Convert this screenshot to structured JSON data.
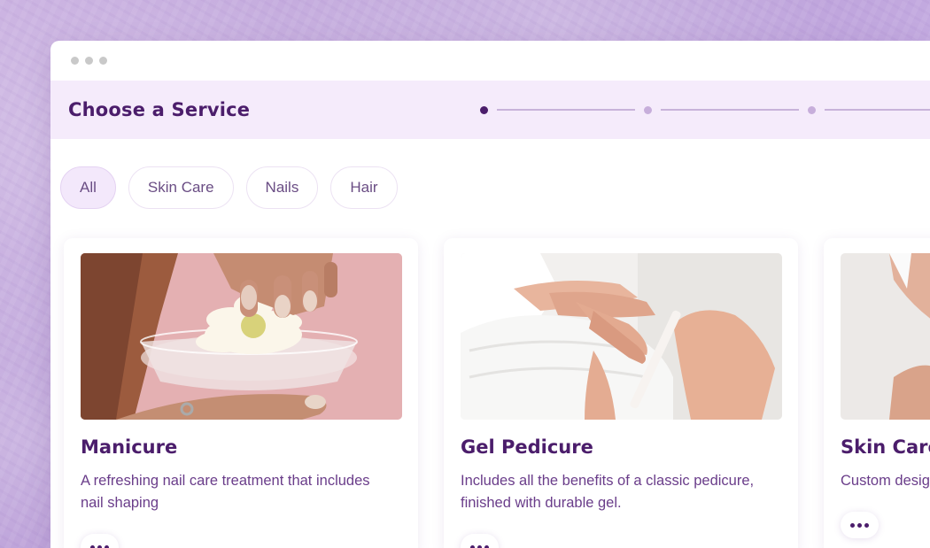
{
  "header": {
    "title": "Choose a Service"
  },
  "filters": [
    {
      "label": "All",
      "active": true
    },
    {
      "label": "Skin Care",
      "active": false
    },
    {
      "label": "Nails",
      "active": false
    },
    {
      "label": "Hair",
      "active": false
    }
  ],
  "steps": {
    "count": 3,
    "current": 1
  },
  "cards": [
    {
      "title": "Manicure",
      "description": "A refreshing nail care treatment that includes nail shaping",
      "image": "manicure-photo"
    },
    {
      "title": "Gel Pedicure",
      "description": "Includes all the benefits of a classic pedicure, finished with durable gel.",
      "image": "gel-pedicure-photo"
    },
    {
      "title": "Skin Care",
      "description": "Custom desig your manicure",
      "image": "skin-care-photo"
    }
  ],
  "colors": {
    "accent": "#4b1d6b",
    "header_bg": "#f5ebfb",
    "chip_active_bg": "#f3e8fb"
  }
}
